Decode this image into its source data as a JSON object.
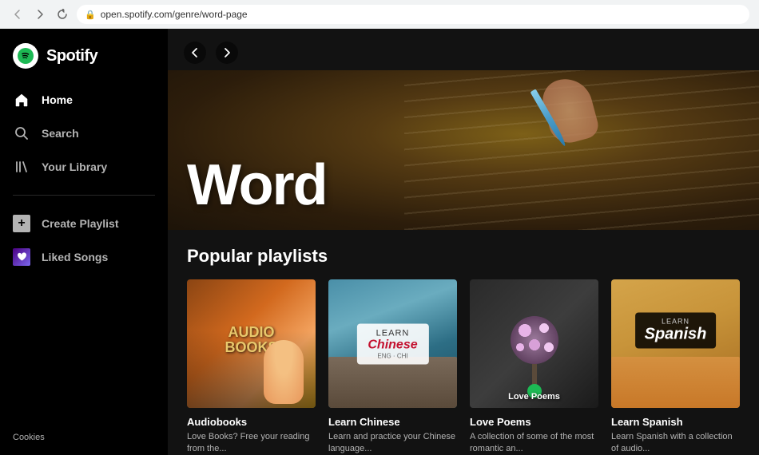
{
  "browser": {
    "back_label": "‹",
    "forward_label": "›",
    "refresh_label": "↻",
    "url": "open.spotify.com/genre/word-page",
    "lock_icon": "🔒"
  },
  "sidebar": {
    "logo_text": "Spotify",
    "nav_items": [
      {
        "id": "home",
        "label": "Home",
        "active": true
      },
      {
        "id": "search",
        "label": "Search",
        "active": false
      },
      {
        "id": "library",
        "label": "Your Library",
        "active": false
      }
    ],
    "actions": [
      {
        "id": "create-playlist",
        "label": "Create Playlist"
      },
      {
        "id": "liked-songs",
        "label": "Liked Songs"
      }
    ],
    "footer": "Cookies"
  },
  "topnav": {
    "back_arrow": "‹",
    "forward_arrow": "›"
  },
  "hero": {
    "title": "Word"
  },
  "popular_playlists": {
    "section_title": "Popular playlists",
    "playlists": [
      {
        "id": "audiobooks",
        "name": "Audiobooks",
        "description": "Love Books? Free your reading from the...",
        "thumb_label": "AUDIO\nBOOKS"
      },
      {
        "id": "learn-chinese",
        "name": "Learn Chinese",
        "description": "Learn and practice your Chinese language...",
        "thumb_label_top": "LEARN",
        "thumb_label_main": "Chinese",
        "thumb_label_sub": "ENG · CHI"
      },
      {
        "id": "love-poems",
        "name": "Love Poems",
        "description": "A collection of some of the most romantic an...",
        "overlay_label": "Love Poems"
      },
      {
        "id": "learn-spanish",
        "name": "Learn Spanish",
        "description": "Learn Spanish with a collection of audio...",
        "thumb_label_learn": "LEARN",
        "thumb_label_main": "Spanish"
      }
    ]
  }
}
